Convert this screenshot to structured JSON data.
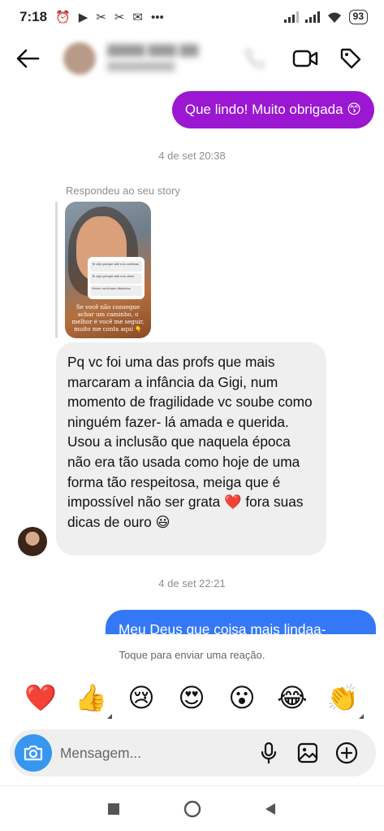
{
  "status_bar": {
    "time": "7:18",
    "icons": [
      "alarm-icon",
      "play-icon",
      "capcut-icon",
      "capcut-icon",
      "gmail-icon",
      "more-icon"
    ],
    "battery": "93"
  },
  "header": {
    "icons": [
      "back-arrow-icon",
      "video-call-icon",
      "tag-icon"
    ]
  },
  "messages": {
    "sent_1": "Que lindo! Muito obrigada 😙",
    "timestamp_1": "4 de set 20:38",
    "reply_label": "Respondeu ao seu story",
    "story": {
      "rows": [
        "Te vejo porque adé nos cortesas",
        "Te vejo porque adé nos cheio",
        "Venho na Amoeo dhimolus"
      ],
      "caption": "Se você não consegue achar um caminho, o melhor é você me seguir, muito me conta aqui 👇"
    },
    "received_1": "Pq vc foi uma das profs que mais marcaram a infância da Gigi, num momento de fragilidade vc soube como ninguém fazer- lá amada e querida. Usou a inclusão que naquela época não era tão usada como hoje de uma forma tão respeitosa, meiga que é impossível não ser grata ❤️ fora suas dicas de ouro 😃",
    "timestamp_2": "4 de set 22:21",
    "sent_2": "Meu Deus que coisa mais lindaa-"
  },
  "reactions": {
    "hint": "Toque para enviar uma reação.",
    "emojis": [
      "❤️",
      "👍",
      "😢",
      "😍",
      "😮",
      "😂",
      "👏"
    ]
  },
  "composer": {
    "placeholder": "Mensagem..."
  },
  "colors": {
    "purple_bubble": "#9b17d1",
    "blue_bubble": "#3478f6",
    "received_bubble": "#efefef",
    "camera_button": "#3797f0"
  }
}
